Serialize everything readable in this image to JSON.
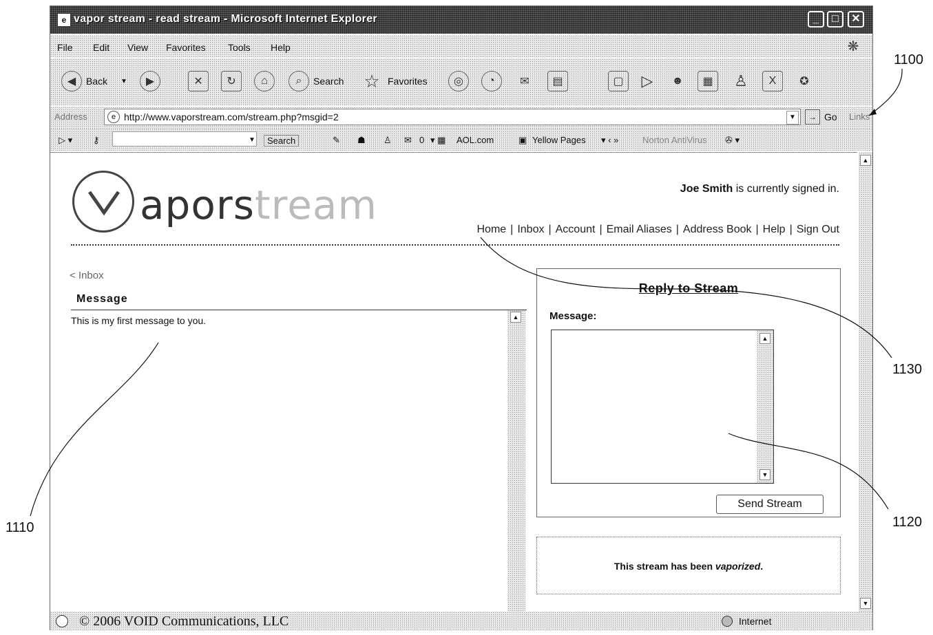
{
  "window": {
    "title": "vapor stream - read stream - Microsoft Internet Explorer",
    "controls": {
      "minimize": "_",
      "maximize": "□",
      "close": "✕"
    }
  },
  "menu": {
    "items": [
      {
        "key": "F",
        "rest": "ile"
      },
      {
        "key": "E",
        "rest": "dit"
      },
      {
        "key": "V",
        "rest": "iew"
      },
      {
        "key": "F",
        "pre": "F",
        "key2": "a",
        "rest": "vorites"
      },
      {
        "key": "T",
        "rest": "ools"
      },
      {
        "key": "H",
        "rest": "elp"
      }
    ],
    "file": "File",
    "edit": "Edit",
    "view": "View",
    "favorites": "Favorites",
    "tools": "Tools",
    "help": "Help"
  },
  "toolbar": {
    "back": "Back",
    "search": "Search",
    "favorites": "Favorites"
  },
  "address": {
    "label": "Address",
    "url": "http://www.vaporstream.com/stream.php?msgid=2",
    "go": "Go",
    "links": "Links"
  },
  "aol": {
    "search_btn": "Search",
    "count": "0",
    "aol_com": "AOL.com",
    "yellow_pages": "Yellow Pages",
    "norton": "Norton AntiVirus"
  },
  "page": {
    "logo": {
      "prefix": "apors",
      "suffix": "tream"
    },
    "user_name": "Joe Smith",
    "signed_in_suffix": " is currently signed in.",
    "nav": [
      "Home",
      "Inbox",
      "Account",
      "Email Aliases",
      "Address Book",
      "Help",
      "Sign Out"
    ],
    "back_link": "< Inbox",
    "message_heading": "Message",
    "message_text": "This is my first message to you.",
    "reply": {
      "title": "Reply to Stream",
      "label": "Message:",
      "send": "Send Stream"
    },
    "vaporized": {
      "prefix": "This stream has been ",
      "emph": "vaporized",
      "suffix": "."
    }
  },
  "status": {
    "copyright": "© 2006 VOID Communications, LLC",
    "zone": "Internet"
  },
  "references": [
    "1100",
    "1110",
    "1120",
    "1130"
  ]
}
